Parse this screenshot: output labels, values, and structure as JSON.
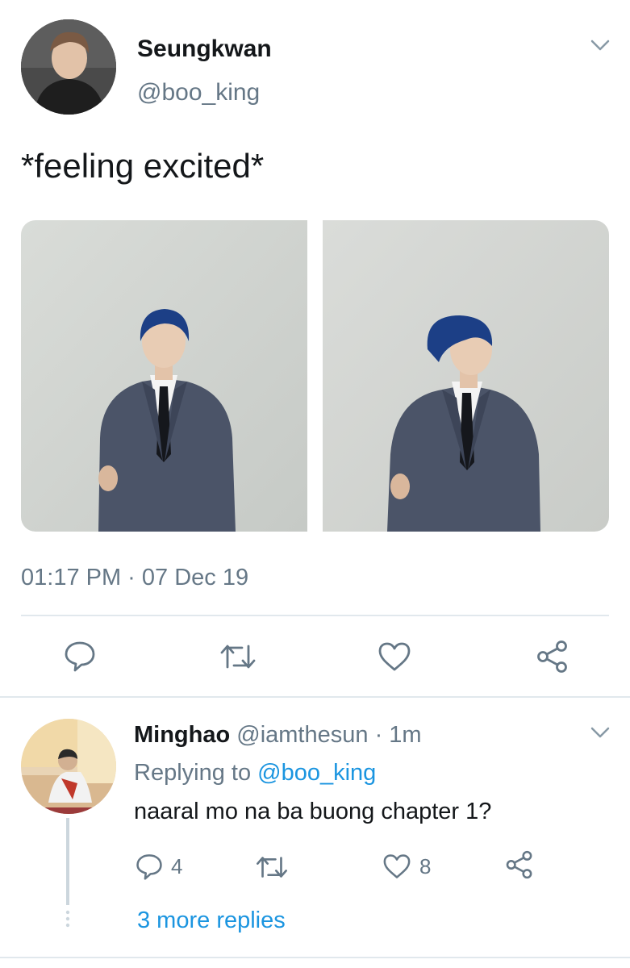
{
  "tweet": {
    "author_name": "Seungkwan",
    "author_handle": "@boo_king",
    "text": "*feeling excited*",
    "timestamp": "01:17 PM · 07 Dec 19",
    "photos": [
      {
        "subject": "man in grey suit, blue hair, facing camera"
      },
      {
        "subject": "man in grey suit, blue hair, looking to the side"
      }
    ],
    "actions": {
      "reply_icon": "reply-icon",
      "retweet_icon": "retweet-icon",
      "like_icon": "heart-icon",
      "share_icon": "share-icon"
    }
  },
  "reply": {
    "author_name": "Minghao",
    "author_handle": "@iamthesun",
    "age": "· 1m",
    "replying_prefix": "Replying to",
    "replying_handle": "@boo_king",
    "text": "naaral mo na ba buong chapter 1?",
    "reply_count": "4",
    "like_count": "8",
    "more_replies": "3 more replies"
  },
  "colors": {
    "accent": "#1b95e0",
    "muted": "#657786",
    "divider": "#e1e8ed",
    "suit": "#4b5468",
    "hair": "#1c3f86"
  }
}
